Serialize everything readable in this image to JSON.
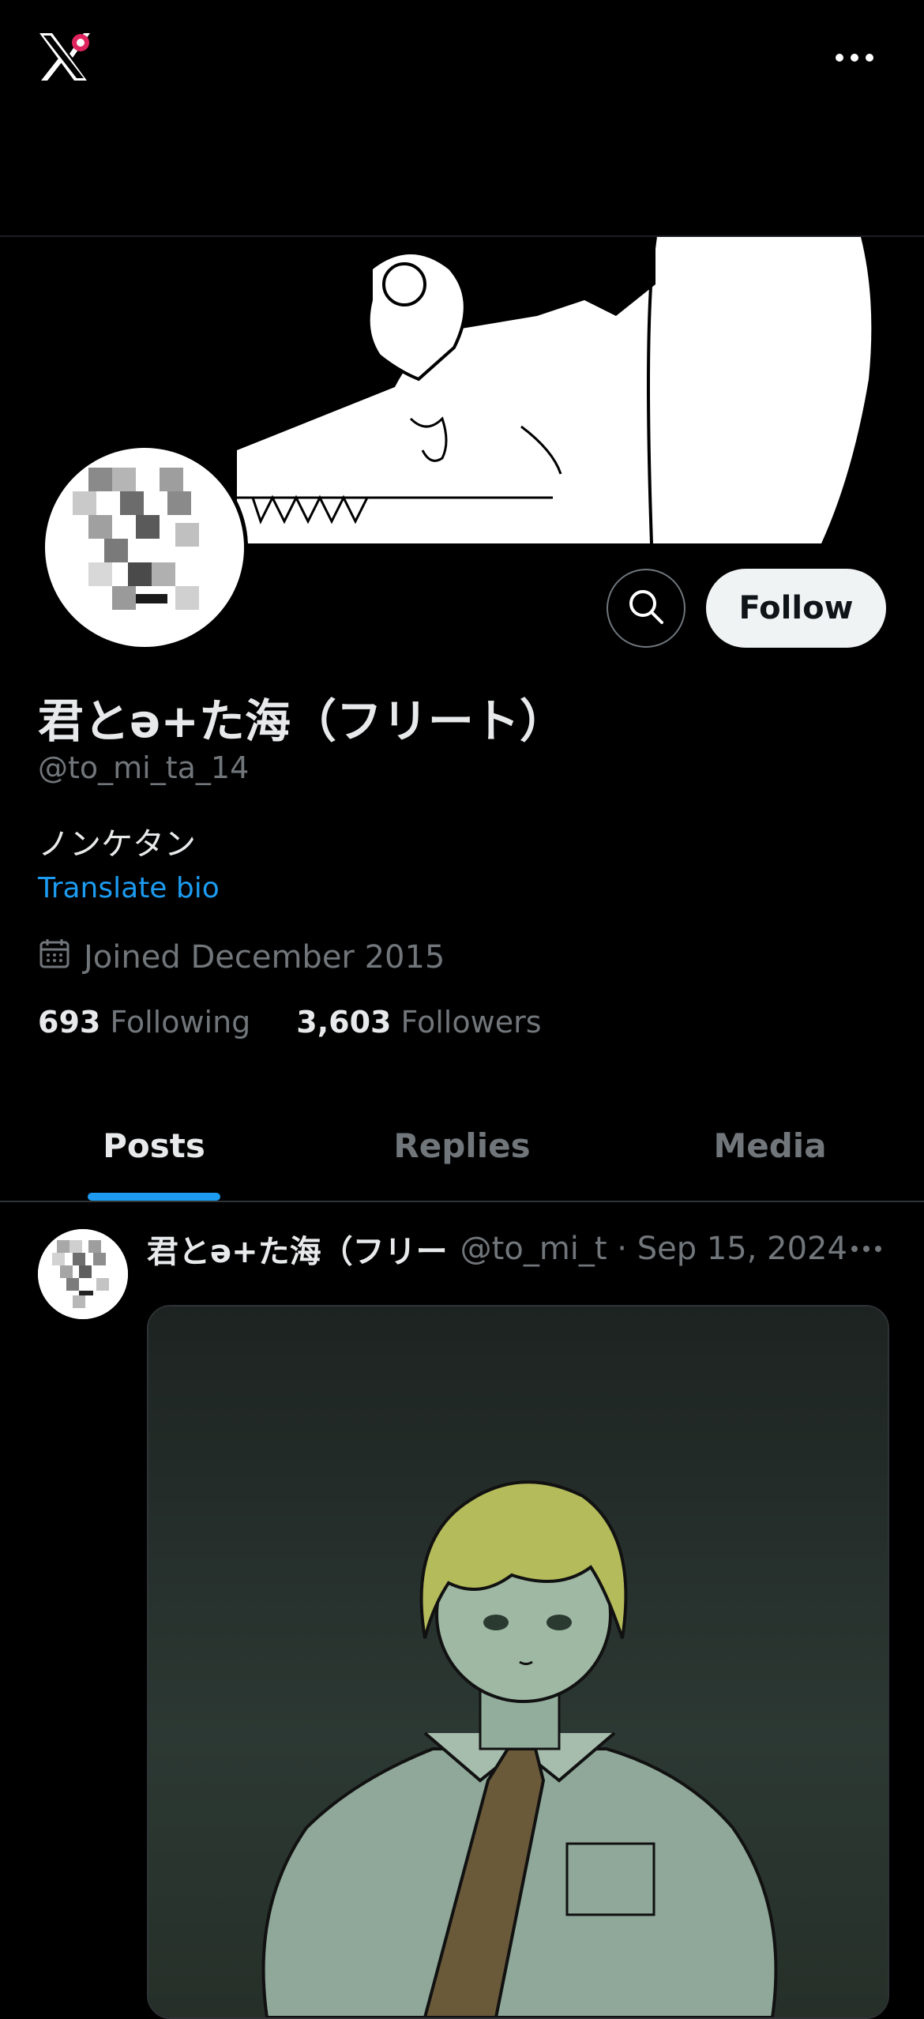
{
  "header": {
    "logo_icon": "x-logo-icon",
    "more_icon": "more-horizontal-icon"
  },
  "profile": {
    "display_name": "君とə+た海（フリート）",
    "handle": "@to_mi_ta_14",
    "bio": "ノンケタン",
    "translate_label": "Translate bio",
    "joined": "Joined December 2015",
    "following_count": "693",
    "following_label": "Following",
    "followers_count": "3,603",
    "followers_label": "Followers",
    "follow_label": "Follow"
  },
  "tabs": [
    {
      "label": "Posts",
      "active": true
    },
    {
      "label": "Replies",
      "active": false
    },
    {
      "label": "Media",
      "active": false
    }
  ],
  "post": {
    "name": "君とə+た海（フリー",
    "meta": "@to_mi_t · Sep 15, 2024"
  },
  "colors": {
    "background": "#000000",
    "accent": "#1d9bf0",
    "text_primary": "#e7e9ea",
    "text_secondary": "#71767b"
  }
}
